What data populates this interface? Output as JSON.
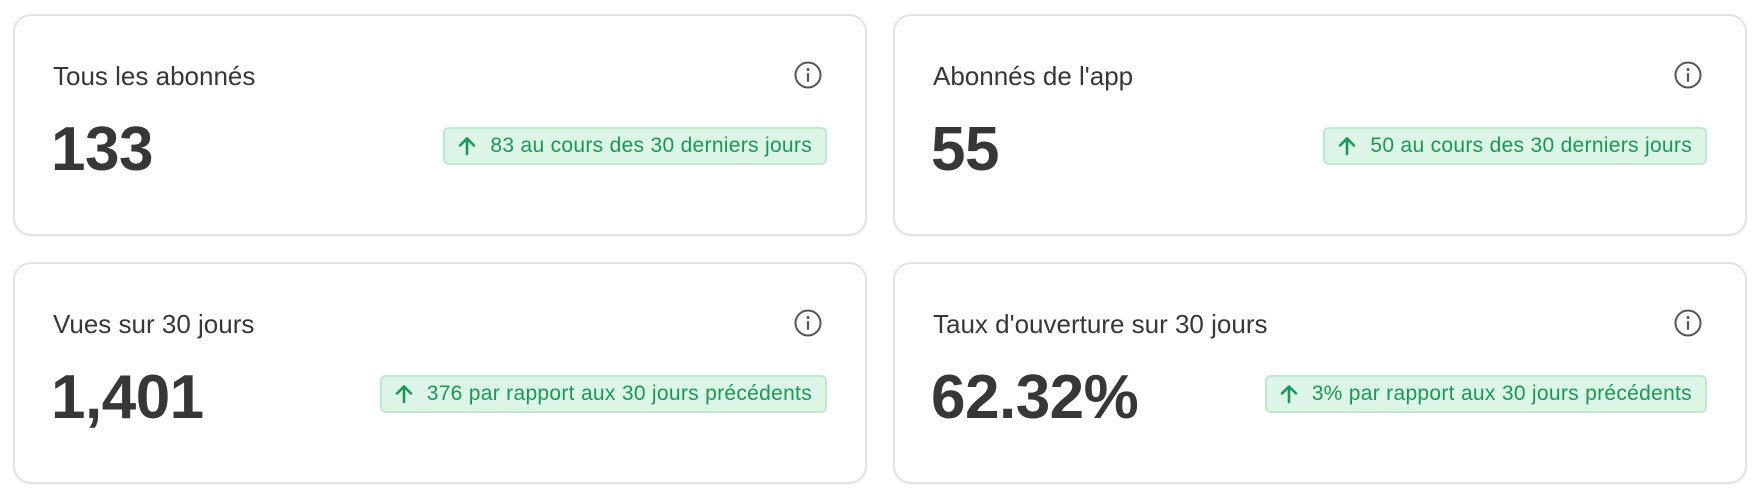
{
  "cards": [
    {
      "title": "Tous les abonnés",
      "value": "133",
      "trend": "83 au cours des 30 derniers jours",
      "trend_direction": "up",
      "icon": "info-icon"
    },
    {
      "title": "Abonnés de l'app",
      "value": "55",
      "trend": "50 au cours des 30 derniers jours",
      "trend_direction": "up",
      "icon": "info-icon"
    },
    {
      "title": "Vues sur 30 jours",
      "value": "1,401",
      "trend": "376 par rapport aux 30 jours précédents",
      "trend_direction": "up",
      "icon": "info-icon"
    },
    {
      "title": "Taux d'ouverture sur 30 jours",
      "value": "62.32%",
      "trend": "3% par rapport aux 30 jours précédents",
      "trend_direction": "up",
      "icon": "info-icon"
    }
  ],
  "colors": {
    "text": "#363737",
    "badge_background": "#dcf5e6",
    "badge_border": "#bde9cf",
    "badge_text": "#179a58",
    "card_border": "#e3e3e3"
  }
}
